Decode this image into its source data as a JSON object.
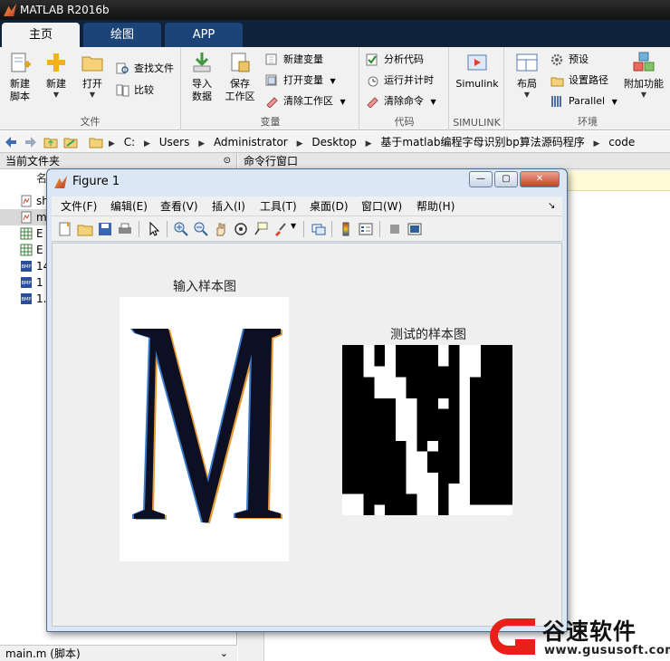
{
  "app": {
    "title": "MATLAB R2016b"
  },
  "tabs": [
    {
      "label": "主页"
    },
    {
      "label": "绘图"
    },
    {
      "label": "APP"
    }
  ],
  "ribbon": {
    "file": {
      "group_label": "文件",
      "new_script": "新建\n脚本",
      "new": "新建",
      "open": "打开",
      "find_files": "查找文件",
      "compare": "比较"
    },
    "variable": {
      "group_label": "变量",
      "import_data": "导入\n数据",
      "save_workspace": "保存\n工作区",
      "new_variable": "新建变量",
      "open_variable": "打开变量",
      "clear_workspace": "清除工作区"
    },
    "code": {
      "group_label": "代码",
      "analyze_code": "分析代码",
      "run_and_time": "运行并计时",
      "clear_commands": "清除命令"
    },
    "simulink": {
      "group_label": "SIMULINK",
      "simulink": "Simulink"
    },
    "environment": {
      "group_label": "环境",
      "layout": "布局",
      "preferences": "预设",
      "set_path": "设置路径",
      "parallel": "Parallel",
      "addons": "附加功能"
    }
  },
  "address": {
    "crumbs": [
      "C:",
      "Users",
      "Administrator",
      "Desktop",
      "基于matlab编程字母识别bp算法源码程序",
      "code"
    ]
  },
  "current_folder": {
    "title": "当前文件夹",
    "name_header": "名",
    "files": [
      {
        "name": "sh",
        "icon": "m-file-icon"
      },
      {
        "name": "m",
        "icon": "m-file-icon"
      },
      {
        "name": "E",
        "icon": "excel-file-icon"
      },
      {
        "name": "E",
        "icon": "excel-file-icon"
      },
      {
        "name": "14",
        "icon": "bmp-file-icon"
      },
      {
        "name": "1",
        "icon": "bmp-file-icon"
      },
      {
        "name": "1.",
        "icon": "bmp-file-icon"
      }
    ],
    "footer": "main.m  (脚本)"
  },
  "command_window": {
    "title": "命令行窗口"
  },
  "figure": {
    "title": "Figure 1",
    "menus": [
      "文件(F)",
      "编辑(E)",
      "查看(V)",
      "插入(I)",
      "工具(T)",
      "桌面(D)",
      "窗口(W)",
      "帮助(H)"
    ],
    "left_axes_title": "输入样本图",
    "right_axes_title": "测试的样本图"
  },
  "watermark": {
    "name": "谷速软件",
    "url": "www.gususoft.com",
    "color": "#e8201a"
  }
}
